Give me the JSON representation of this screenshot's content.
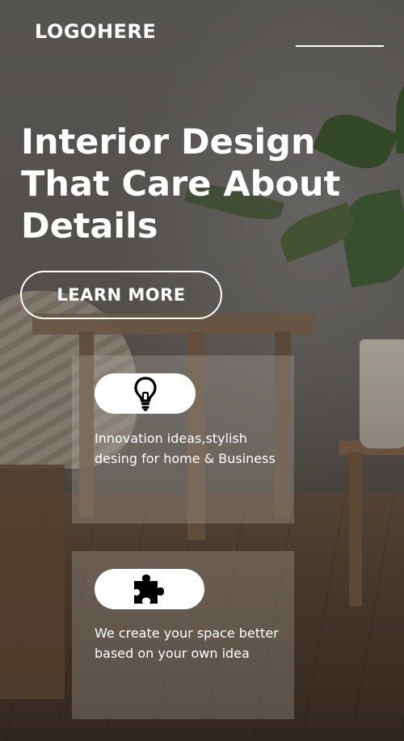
{
  "header": {
    "logo_text": "LOGOHERE",
    "menu_icon": "menu-line-icon"
  },
  "hero": {
    "title": "Interior Design That Care About Details",
    "cta_label": "LEARN MORE"
  },
  "features": [
    {
      "icon": "lightbulb-icon",
      "text": "Innovation ideas,stylish desing for home & Business"
    },
    {
      "icon": "puzzle-piece-icon",
      "text": "We create your space better based on your own idea"
    }
  ],
  "colors": {
    "text": "#ffffff",
    "icon": "#000000",
    "pill_background": "#ffffff"
  }
}
